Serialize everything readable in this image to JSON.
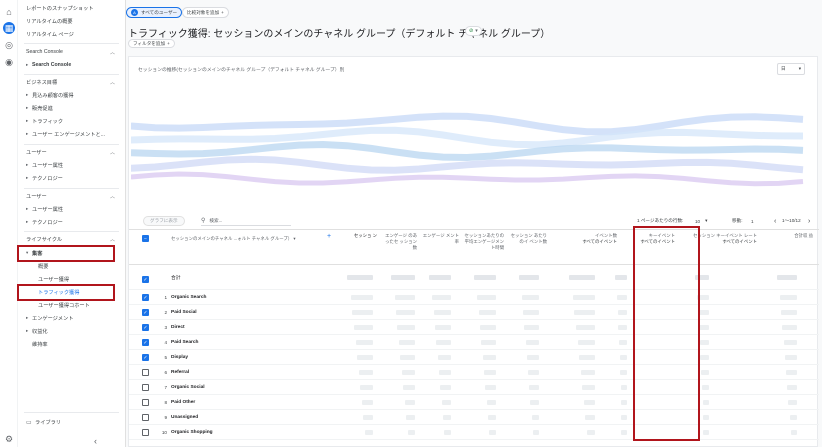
{
  "rail": {
    "icons": [
      "home-icon",
      "reports-icon",
      "explore-icon",
      "advertising-icon"
    ],
    "settings_icon": "gear-icon"
  },
  "nav": {
    "snapshot": "レポートのスナップショット",
    "realtime_overview": "リアルタイムの概要",
    "realtime_pages": "リアルタイム ページ",
    "sc_section": "Search Console",
    "sc_item": "Search Console",
    "business_section": "ビジネス目標",
    "business_items": [
      "見込み顧客の獲得",
      "販売促進",
      "トラフィック",
      "ユーザー エンゲージメントと..."
    ],
    "user_section": "ユーザー",
    "user_items": [
      "ユーザー属性",
      "テクノロジー"
    ],
    "user2_section": "ユーザー",
    "user2_items": [
      "ユーザー属性",
      "テクノロジー"
    ],
    "lifecycle_section": "ライフサイクル",
    "acquisition": "集客",
    "acquisition_subs": [
      "概要",
      "ユーザー獲得",
      "トラフィック獲得",
      "ユーザー獲得コホート"
    ],
    "engagement": "エンゲージメント",
    "monetization": "収益化",
    "retention": "維持率",
    "library": "ライブラリ",
    "collapse": "‹"
  },
  "header": {
    "all_users_chip": "すべてのユーザー",
    "compare_chip": "比較対象を追加",
    "title": "トラフィック獲得: セッションのメインのチャネル グループ（デフォルト チャネル グループ）",
    "add_filter": "フィルタを追加"
  },
  "chart": {
    "title": "セッションの推移(セッションのメインのチャネル グループ（デフォルト チャネル グループ）別",
    "granularity": "日",
    "colors": [
      "#c6d8f7",
      "#d4e6f9",
      "#b8d6f0",
      "#cfd8f5",
      "#d8c7f0"
    ]
  },
  "toolbar": {
    "plot_rows": "グラフに表示",
    "search_placeholder": "検索...",
    "rows_per_page_label": "1 ページあたりの行数:",
    "rows_per_page": "10",
    "goto_label": "移動:",
    "goto_value": "1",
    "range": "1～10/12"
  },
  "table": {
    "dim_header": "セッションのメインのチャネル ...ォルト チャネル グループ）",
    "columns": [
      {
        "label": "セッショ ン"
      },
      {
        "label": "エンゲージ のあったセ ッション数"
      },
      {
        "label": "エンゲージ メント率"
      },
      {
        "label": "セッションあたりの平均エンゲージメント時間"
      },
      {
        "label": "セッション あたりのイ ベント数"
      },
      {
        "label": "イベント数",
        "sub": "すべてのイベント"
      },
      {
        "label": "キーイベント",
        "sub": "すべてのイベント"
      },
      {
        "label": "セッション キーイベント レート",
        "sub": "すべてのイベント"
      },
      {
        "label": "合計収 益"
      }
    ],
    "total_label": "合計",
    "rows": [
      {
        "idx": "1",
        "label": "Organic Search",
        "checked": true
      },
      {
        "idx": "2",
        "label": "Paid Social",
        "checked": true
      },
      {
        "idx": "3",
        "label": "Direct",
        "checked": true
      },
      {
        "idx": "4",
        "label": "Paid Search",
        "checked": true
      },
      {
        "idx": "5",
        "label": "Display",
        "checked": true
      },
      {
        "idx": "6",
        "label": "Referral",
        "checked": false
      },
      {
        "idx": "7",
        "label": "Organic Social",
        "checked": false
      },
      {
        "idx": "8",
        "label": "Paid Other",
        "checked": false
      },
      {
        "idx": "9",
        "label": "Unassigned",
        "checked": false
      },
      {
        "idx": "10",
        "label": "Organic Shopping",
        "checked": false
      }
    ]
  }
}
